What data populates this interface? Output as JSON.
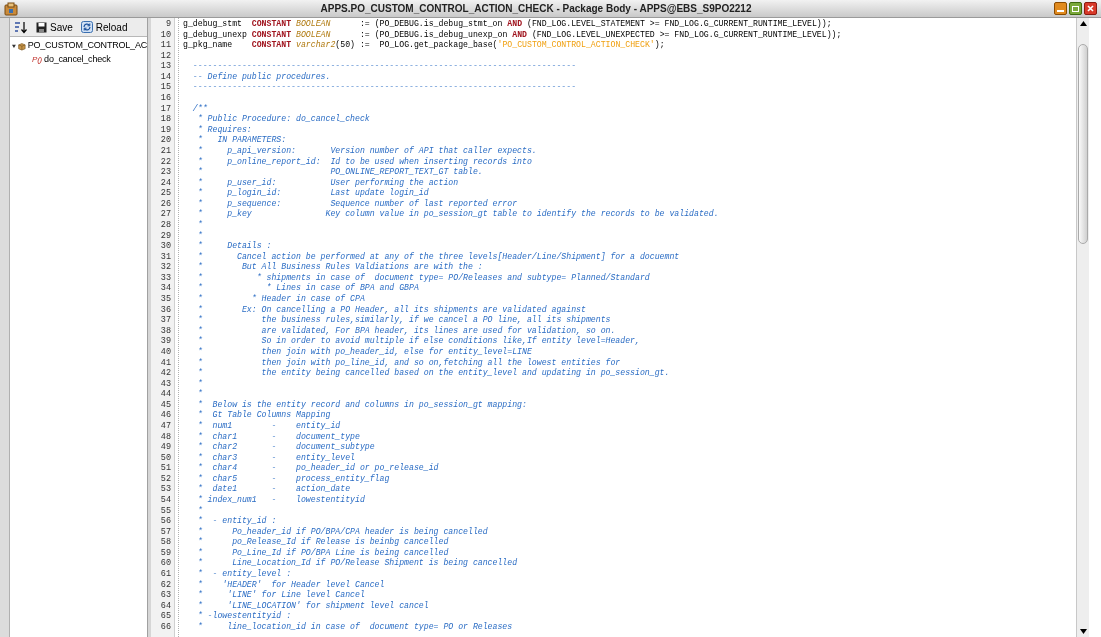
{
  "window": {
    "title": "APPS.PO_CUSTOM_CONTROL_ACTION_CHECK - Package Body - APPS@EBS_S9PO2212"
  },
  "toolbar": {
    "buttons": [
      {
        "kind": "save",
        "label": "Save"
      },
      {
        "kind": "reload",
        "label": "Reload"
      }
    ]
  },
  "tree": {
    "items": [
      {
        "kind": "package",
        "label": "PO_CUSTOM_CONTROL_AC",
        "expanded": true,
        "children": [
          {
            "kind": "procedure",
            "icon_text": "P()",
            "label": "do_cancel_check"
          }
        ]
      }
    ]
  },
  "editor": {
    "lines": [
      {
        "number": "9",
        "tokens": [
          {
            "kind": "plain",
            "text": "g_debug_stmt  "
          },
          {
            "kind": "keyword",
            "text": "CONSTANT"
          },
          {
            "kind": "type",
            "text": " BOOLEAN"
          },
          {
            "kind": "plain",
            "text": "      := (PO_DEBUG.is_debug_stmt_on "
          },
          {
            "kind": "keyword",
            "text": "AND"
          },
          {
            "kind": "plain",
            "text": " (FND_LOG.LEVEL_STATEMENT >= FND_LOG.G_CURRENT_RUNTIME_LEVEL));"
          }
        ]
      },
      {
        "number": "10",
        "tokens": [
          {
            "kind": "plain",
            "text": "g_debug_unexp "
          },
          {
            "kind": "keyword",
            "text": "CONSTANT"
          },
          {
            "kind": "type",
            "text": " BOOLEAN"
          },
          {
            "kind": "plain",
            "text": "      := (PO_DEBUG.is_debug_unexp_on "
          },
          {
            "kind": "keyword",
            "text": "AND"
          },
          {
            "kind": "plain",
            "text": " (FND_LOG.LEVEL_UNEXPECTED >= FND_LOG.G_CURRENT_RUNTIME_LEVEL));"
          }
        ]
      },
      {
        "number": "11",
        "tokens": [
          {
            "kind": "plain",
            "text": "g_pkg_name    "
          },
          {
            "kind": "keyword",
            "text": "CONSTANT"
          },
          {
            "kind": "type",
            "text": " varchar2"
          },
          {
            "kind": "plain",
            "text": "(50) :=  PO_LOG.get_package_base("
          },
          {
            "kind": "string",
            "text": "'PO_CUSTOM_CONTROL_ACTION_CHECK'"
          },
          {
            "kind": "plain",
            "text": ");"
          }
        ]
      },
      {
        "number": "12"
      },
      {
        "number": "13",
        "tokens": [
          {
            "kind": "comment",
            "text": "  ------------------------------------------------------------------------------"
          }
        ]
      },
      {
        "number": "14",
        "tokens": [
          {
            "kind": "comment",
            "text": "  -- Define public procedures."
          }
        ]
      },
      {
        "number": "15",
        "tokens": [
          {
            "kind": "comment",
            "text": "  ------------------------------------------------------------------------------"
          }
        ]
      },
      {
        "number": "16"
      },
      {
        "number": "17",
        "tokens": [
          {
            "kind": "comment",
            "text": "  /**"
          }
        ]
      },
      {
        "number": "18",
        "tokens": [
          {
            "kind": "comment",
            "text": "   * Public Procedure: do_cancel_check"
          }
        ]
      },
      {
        "number": "19",
        "tokens": [
          {
            "kind": "comment",
            "text": "   * Requires:"
          }
        ]
      },
      {
        "number": "20",
        "tokens": [
          {
            "kind": "comment",
            "text": "   *   IN PARAMETERS:"
          }
        ]
      },
      {
        "number": "21",
        "tokens": [
          {
            "kind": "comment",
            "text": "   *     p_api_version:       Version number of API that caller expects."
          }
        ]
      },
      {
        "number": "22",
        "tokens": [
          {
            "kind": "comment",
            "text": "   *     p_online_report_id:  Id to be used when inserting records into"
          }
        ]
      },
      {
        "number": "23",
        "tokens": [
          {
            "kind": "comment",
            "text": "   *                          PO_ONLINE_REPORT_TEXT_GT table."
          }
        ]
      },
      {
        "number": "24",
        "tokens": [
          {
            "kind": "comment",
            "text": "   *     p_user_id:           User performing the action"
          }
        ]
      },
      {
        "number": "25",
        "tokens": [
          {
            "kind": "comment",
            "text": "   *     p_login_id:          Last update login_id"
          }
        ]
      },
      {
        "number": "26",
        "tokens": [
          {
            "kind": "comment",
            "text": "   *     p_sequence:          Sequence number of last reported error"
          }
        ]
      },
      {
        "number": "27",
        "tokens": [
          {
            "kind": "comment",
            "text": "   *     p_key               Key column value in po_session_gt table to identify the records to be validated."
          }
        ]
      },
      {
        "number": "28",
        "tokens": [
          {
            "kind": "comment",
            "text": "   *"
          }
        ]
      },
      {
        "number": "29",
        "tokens": [
          {
            "kind": "comment",
            "text": "   *"
          }
        ]
      },
      {
        "number": "30",
        "tokens": [
          {
            "kind": "comment",
            "text": "   *     Details :"
          }
        ]
      },
      {
        "number": "31",
        "tokens": [
          {
            "kind": "comment",
            "text": "   *       Cancel action be performed at any of the three levels[Header/Line/Shipment] for a docuemnt"
          }
        ]
      },
      {
        "number": "32",
        "tokens": [
          {
            "kind": "comment",
            "text": "   *        But All Business Rules Valdiations are with the :"
          }
        ]
      },
      {
        "number": "33",
        "tokens": [
          {
            "kind": "comment",
            "text": "   *           * shipments in case of  document type= PO/Releases and subtype= Planned/Standard"
          }
        ]
      },
      {
        "number": "34",
        "tokens": [
          {
            "kind": "comment",
            "text": "   *             * Lines in case of BPA and GBPA"
          }
        ]
      },
      {
        "number": "35",
        "tokens": [
          {
            "kind": "comment",
            "text": "   *          * Header in case of CPA"
          }
        ]
      },
      {
        "number": "36",
        "tokens": [
          {
            "kind": "comment",
            "text": "   *        Ex: On cancelling a PO Header, all its shipments are validated against"
          }
        ]
      },
      {
        "number": "37",
        "tokens": [
          {
            "kind": "comment",
            "text": "   *            the business rules,similarly, if we cancel a PO line, all its shipments"
          }
        ]
      },
      {
        "number": "38",
        "tokens": [
          {
            "kind": "comment",
            "text": "   *            are validated, For BPA header, its lines are used for validation, so on."
          }
        ]
      },
      {
        "number": "39",
        "tokens": [
          {
            "kind": "comment",
            "text": "   *            So in order to avoid multiple if else conditions like,If entity level=Header,"
          }
        ]
      },
      {
        "number": "40",
        "tokens": [
          {
            "kind": "comment",
            "text": "   *            then join with po_header_id, else for entity_level=LINE"
          }
        ]
      },
      {
        "number": "41",
        "tokens": [
          {
            "kind": "comment",
            "text": "   *            then join with po_line_id, and so on,fetching all the lowest entities for"
          }
        ]
      },
      {
        "number": "42",
        "tokens": [
          {
            "kind": "comment",
            "text": "   *            the entity being cancelled based on the entity_level and updating in po_session_gt."
          }
        ]
      },
      {
        "number": "43",
        "tokens": [
          {
            "kind": "comment",
            "text": "   *"
          }
        ]
      },
      {
        "number": "44",
        "tokens": [
          {
            "kind": "comment",
            "text": "   *"
          }
        ]
      },
      {
        "number": "45",
        "tokens": [
          {
            "kind": "comment",
            "text": "   *  Below is the entity record and columns in po_session_gt mapping:"
          }
        ]
      },
      {
        "number": "46",
        "tokens": [
          {
            "kind": "comment",
            "text": "   *  Gt Table Columns Mapping"
          }
        ]
      },
      {
        "number": "47",
        "tokens": [
          {
            "kind": "comment",
            "text": "   *  num1        -    entity_id"
          }
        ]
      },
      {
        "number": "48",
        "tokens": [
          {
            "kind": "comment",
            "text": "   *  char1       -    document_type"
          }
        ]
      },
      {
        "number": "49",
        "tokens": [
          {
            "kind": "comment",
            "text": "   *  char2       -    document_subtype"
          }
        ]
      },
      {
        "number": "50",
        "tokens": [
          {
            "kind": "comment",
            "text": "   *  char3       -    entity_level"
          }
        ]
      },
      {
        "number": "51",
        "tokens": [
          {
            "kind": "comment",
            "text": "   *  char4       -    po_header_id or po_release_id"
          }
        ]
      },
      {
        "number": "52",
        "tokens": [
          {
            "kind": "comment",
            "text": "   *  char5       -    process_entity_flag"
          }
        ]
      },
      {
        "number": "53",
        "tokens": [
          {
            "kind": "comment",
            "text": "   *  date1       -    action_date"
          }
        ]
      },
      {
        "number": "54",
        "tokens": [
          {
            "kind": "comment",
            "text": "   * index_num1   -    lowestentityid"
          }
        ]
      },
      {
        "number": "55",
        "tokens": [
          {
            "kind": "comment",
            "text": "   *"
          }
        ]
      },
      {
        "number": "56",
        "tokens": [
          {
            "kind": "comment",
            "text": "   *  - entity_id :"
          }
        ]
      },
      {
        "number": "57",
        "tokens": [
          {
            "kind": "comment",
            "text": "   *      Po_header_id if PO/BPA/CPA header is being cancelled"
          }
        ]
      },
      {
        "number": "58",
        "tokens": [
          {
            "kind": "comment",
            "text": "   *      po_Release_Id if Release is beinbg cancelled"
          }
        ]
      },
      {
        "number": "59",
        "tokens": [
          {
            "kind": "comment",
            "text": "   *      Po_Line_Id if PO/BPA Line is being cancelled"
          }
        ]
      },
      {
        "number": "60",
        "tokens": [
          {
            "kind": "comment",
            "text": "   *      Line_Location_Id if PO/Release Shipment is being cancelled"
          }
        ]
      },
      {
        "number": "61",
        "tokens": [
          {
            "kind": "comment",
            "text": "   *  - entity_level :"
          }
        ]
      },
      {
        "number": "62",
        "tokens": [
          {
            "kind": "comment",
            "text": "   *    'HEADER'  for Header level Cancel"
          }
        ]
      },
      {
        "number": "63",
        "tokens": [
          {
            "kind": "comment",
            "text": "   *     'LINE' for Line level Cancel"
          }
        ]
      },
      {
        "number": "64",
        "tokens": [
          {
            "kind": "comment",
            "text": "   *     'LINE_LOCATION' for shipment level cancel"
          }
        ]
      },
      {
        "number": "65",
        "tokens": [
          {
            "kind": "comment",
            "text": "   * -lowestentityid :"
          }
        ]
      },
      {
        "number": "66",
        "tokens": [
          {
            "kind": "comment",
            "text": "   *     line_location_id in case of  document type= PO or Releases"
          }
        ]
      }
    ]
  }
}
